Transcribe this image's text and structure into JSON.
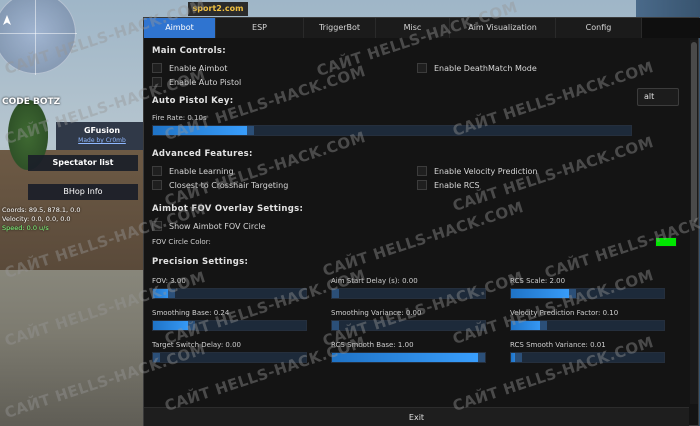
{
  "background": {
    "hud": {
      "codebotz": "CODE BOTZ",
      "gfusion_title": "GFusion",
      "gfusion_sub": "Made by Cr0mb",
      "spectator": "Spectator list",
      "bhop": "BHop Info",
      "coords": "Coords: 89.5, 878.1, 0.0",
      "velocity": "Velocity: 0.0, 0.0, 0.0",
      "speed": "Speed: 0.0 u/s"
    },
    "sign": "sport2.com"
  },
  "watermark": "САЙТ HELLS-HACK.COM",
  "tabs": [
    {
      "label": "Aimbot",
      "active": true
    },
    {
      "label": "ESP",
      "active": false
    },
    {
      "label": "TriggerBot",
      "active": false
    },
    {
      "label": "Misc",
      "active": false
    },
    {
      "label": "Aim Visualization",
      "active": false
    },
    {
      "label": "Config",
      "active": false
    }
  ],
  "main_controls": {
    "title": "Main Controls:",
    "enable_aimbot": "Enable Aimbot",
    "enable_auto_pistol": "Enable Auto Pistol",
    "enable_deathmatch": "Enable DeathMatch Mode"
  },
  "auto_pistol": {
    "key_label": "Auto Pistol Key:",
    "key_value": "alt",
    "fire_rate_label": "Fire Rate: 0.10s",
    "fire_rate_fraction": 0.2
  },
  "advanced": {
    "title": "Advanced Features:",
    "enable_learning": "Enable Learning",
    "closest_crosshair": "Closest to Crosshair Targeting",
    "enable_velocity": "Enable Velocity Prediction",
    "enable_rcs": "Enable RCS"
  },
  "fov_overlay": {
    "title": "Aimbot FOV Overlay Settings:",
    "show_circle": "Show Aimbot FOV Circle",
    "color_label": "FOV Circle Color:",
    "color": "#00e600"
  },
  "precision": {
    "title": "Precision Settings:",
    "sliders": [
      {
        "label": "FOV: 3.00",
        "fraction": 0.1
      },
      {
        "label": "Aim Start Delay (s): 0.00",
        "fraction": 0.0
      },
      {
        "label": "RCS Scale: 2.00",
        "fraction": 0.4
      },
      {
        "label": "Smoothing Base: 0.24",
        "fraction": 0.24
      },
      {
        "label": "Smoothing Variance: 0.00",
        "fraction": 0.0
      },
      {
        "label": "Velocity Prediction Factor: 0.10",
        "fraction": 0.2
      },
      {
        "label": "Target Switch Delay: 0.00",
        "fraction": 0.0
      },
      {
        "label": "RCS Smooth Base: 1.00",
        "fraction": 1.0
      },
      {
        "label": "RCS Smooth Variance: 0.01",
        "fraction": 0.03
      }
    ]
  },
  "exit_label": "Exit",
  "colors": {
    "accent": "#2f74d0",
    "panel_bg": "#141414",
    "slider_fill": "#3aa0ff",
    "speed_text": "#7cff7c"
  }
}
